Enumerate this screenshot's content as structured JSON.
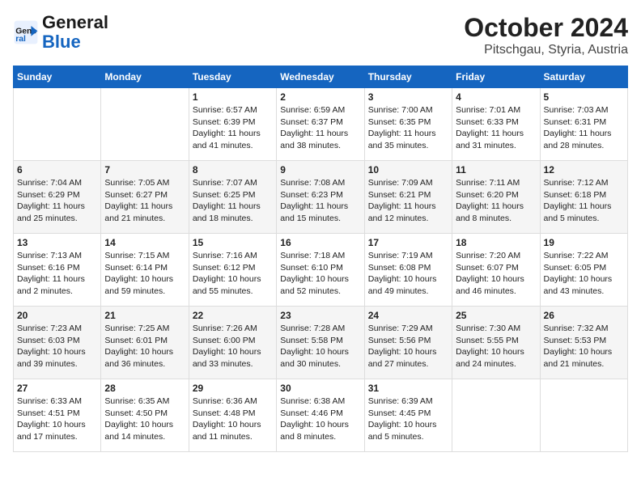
{
  "header": {
    "logo_line1": "General",
    "logo_line2": "Blue",
    "title": "October 2024",
    "subtitle": "Pitschgau, Styria, Austria"
  },
  "days_of_week": [
    "Sunday",
    "Monday",
    "Tuesday",
    "Wednesday",
    "Thursday",
    "Friday",
    "Saturday"
  ],
  "weeks": [
    [
      {
        "num": "",
        "info": ""
      },
      {
        "num": "",
        "info": ""
      },
      {
        "num": "1",
        "info": "Sunrise: 6:57 AM\nSunset: 6:39 PM\nDaylight: 11 hours and 41 minutes."
      },
      {
        "num": "2",
        "info": "Sunrise: 6:59 AM\nSunset: 6:37 PM\nDaylight: 11 hours and 38 minutes."
      },
      {
        "num": "3",
        "info": "Sunrise: 7:00 AM\nSunset: 6:35 PM\nDaylight: 11 hours and 35 minutes."
      },
      {
        "num": "4",
        "info": "Sunrise: 7:01 AM\nSunset: 6:33 PM\nDaylight: 11 hours and 31 minutes."
      },
      {
        "num": "5",
        "info": "Sunrise: 7:03 AM\nSunset: 6:31 PM\nDaylight: 11 hours and 28 minutes."
      }
    ],
    [
      {
        "num": "6",
        "info": "Sunrise: 7:04 AM\nSunset: 6:29 PM\nDaylight: 11 hours and 25 minutes."
      },
      {
        "num": "7",
        "info": "Sunrise: 7:05 AM\nSunset: 6:27 PM\nDaylight: 11 hours and 21 minutes."
      },
      {
        "num": "8",
        "info": "Sunrise: 7:07 AM\nSunset: 6:25 PM\nDaylight: 11 hours and 18 minutes."
      },
      {
        "num": "9",
        "info": "Sunrise: 7:08 AM\nSunset: 6:23 PM\nDaylight: 11 hours and 15 minutes."
      },
      {
        "num": "10",
        "info": "Sunrise: 7:09 AM\nSunset: 6:21 PM\nDaylight: 11 hours and 12 minutes."
      },
      {
        "num": "11",
        "info": "Sunrise: 7:11 AM\nSunset: 6:20 PM\nDaylight: 11 hours and 8 minutes."
      },
      {
        "num": "12",
        "info": "Sunrise: 7:12 AM\nSunset: 6:18 PM\nDaylight: 11 hours and 5 minutes."
      }
    ],
    [
      {
        "num": "13",
        "info": "Sunrise: 7:13 AM\nSunset: 6:16 PM\nDaylight: 11 hours and 2 minutes."
      },
      {
        "num": "14",
        "info": "Sunrise: 7:15 AM\nSunset: 6:14 PM\nDaylight: 10 hours and 59 minutes."
      },
      {
        "num": "15",
        "info": "Sunrise: 7:16 AM\nSunset: 6:12 PM\nDaylight: 10 hours and 55 minutes."
      },
      {
        "num": "16",
        "info": "Sunrise: 7:18 AM\nSunset: 6:10 PM\nDaylight: 10 hours and 52 minutes."
      },
      {
        "num": "17",
        "info": "Sunrise: 7:19 AM\nSunset: 6:08 PM\nDaylight: 10 hours and 49 minutes."
      },
      {
        "num": "18",
        "info": "Sunrise: 7:20 AM\nSunset: 6:07 PM\nDaylight: 10 hours and 46 minutes."
      },
      {
        "num": "19",
        "info": "Sunrise: 7:22 AM\nSunset: 6:05 PM\nDaylight: 10 hours and 43 minutes."
      }
    ],
    [
      {
        "num": "20",
        "info": "Sunrise: 7:23 AM\nSunset: 6:03 PM\nDaylight: 10 hours and 39 minutes."
      },
      {
        "num": "21",
        "info": "Sunrise: 7:25 AM\nSunset: 6:01 PM\nDaylight: 10 hours and 36 minutes."
      },
      {
        "num": "22",
        "info": "Sunrise: 7:26 AM\nSunset: 6:00 PM\nDaylight: 10 hours and 33 minutes."
      },
      {
        "num": "23",
        "info": "Sunrise: 7:28 AM\nSunset: 5:58 PM\nDaylight: 10 hours and 30 minutes."
      },
      {
        "num": "24",
        "info": "Sunrise: 7:29 AM\nSunset: 5:56 PM\nDaylight: 10 hours and 27 minutes."
      },
      {
        "num": "25",
        "info": "Sunrise: 7:30 AM\nSunset: 5:55 PM\nDaylight: 10 hours and 24 minutes."
      },
      {
        "num": "26",
        "info": "Sunrise: 7:32 AM\nSunset: 5:53 PM\nDaylight: 10 hours and 21 minutes."
      }
    ],
    [
      {
        "num": "27",
        "info": "Sunrise: 6:33 AM\nSunset: 4:51 PM\nDaylight: 10 hours and 17 minutes."
      },
      {
        "num": "28",
        "info": "Sunrise: 6:35 AM\nSunset: 4:50 PM\nDaylight: 10 hours and 14 minutes."
      },
      {
        "num": "29",
        "info": "Sunrise: 6:36 AM\nSunset: 4:48 PM\nDaylight: 10 hours and 11 minutes."
      },
      {
        "num": "30",
        "info": "Sunrise: 6:38 AM\nSunset: 4:46 PM\nDaylight: 10 hours and 8 minutes."
      },
      {
        "num": "31",
        "info": "Sunrise: 6:39 AM\nSunset: 4:45 PM\nDaylight: 10 hours and 5 minutes."
      },
      {
        "num": "",
        "info": ""
      },
      {
        "num": "",
        "info": ""
      }
    ]
  ]
}
